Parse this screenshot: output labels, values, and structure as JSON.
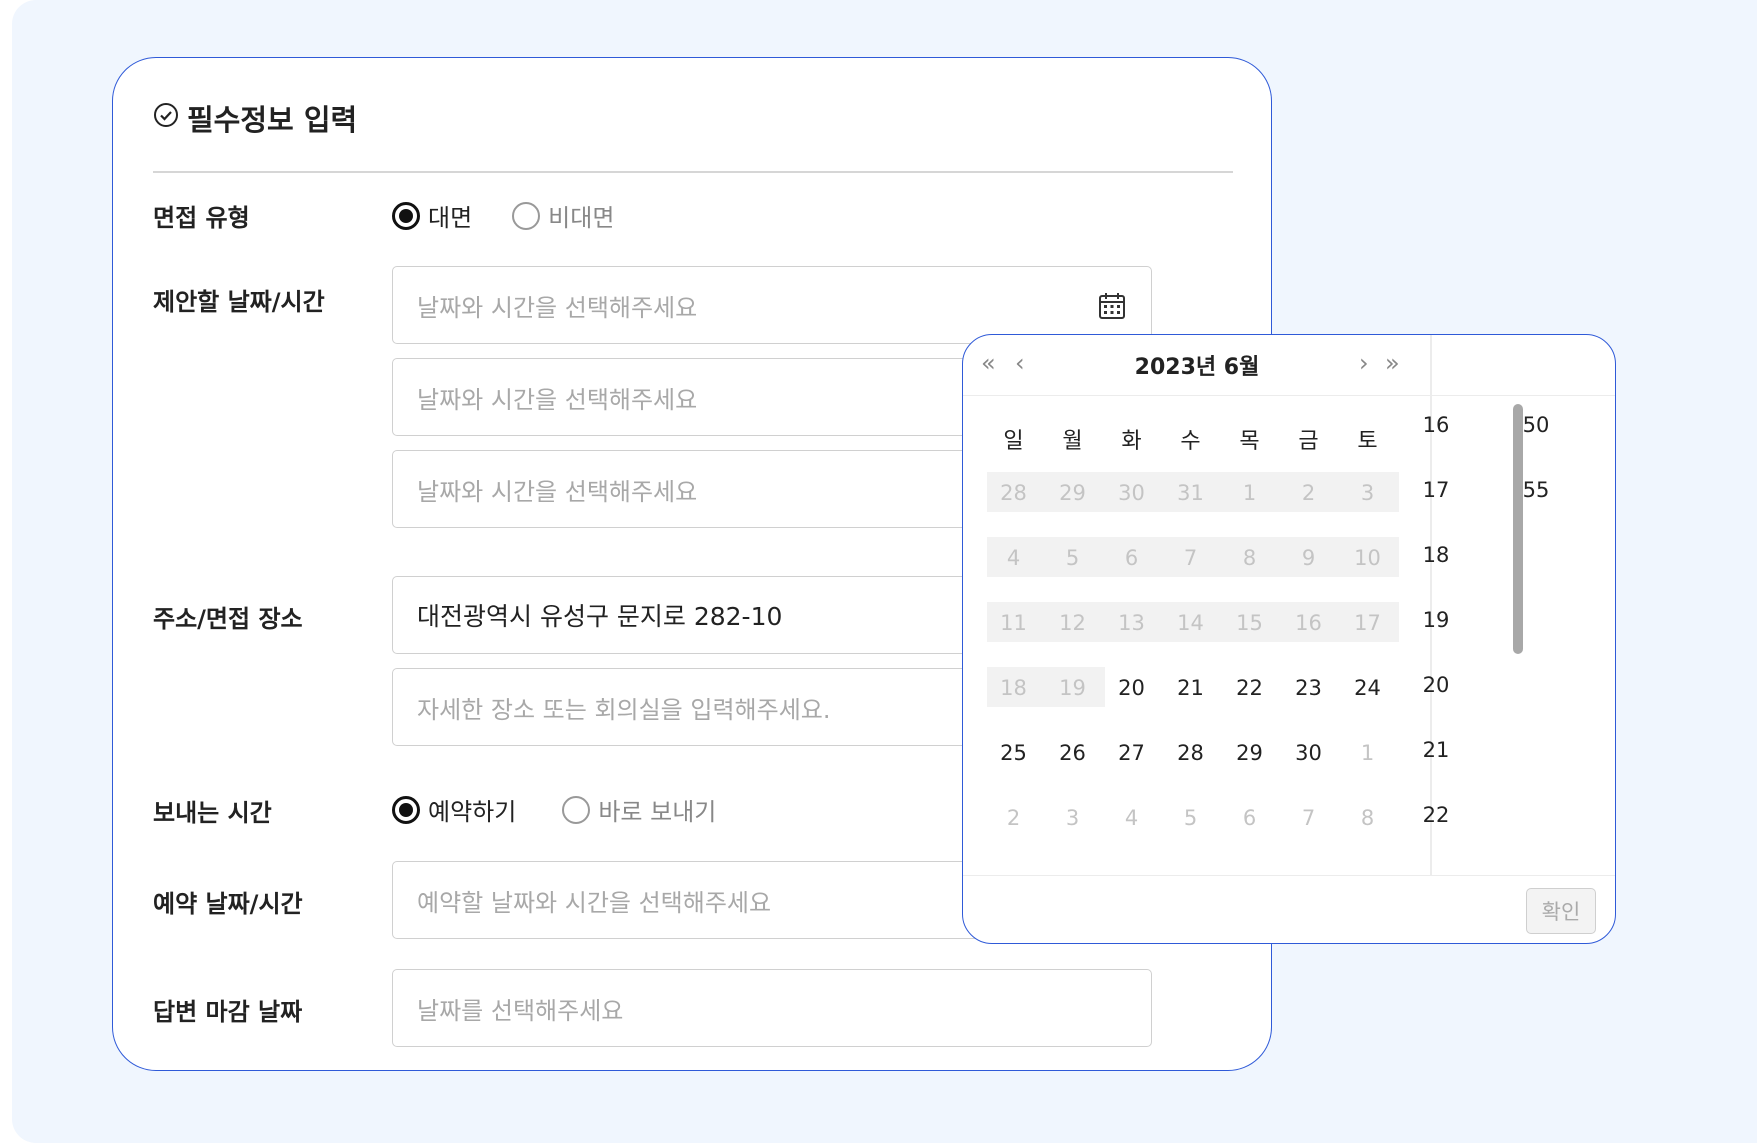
{
  "form": {
    "title": "필수정보 입력",
    "interview_type": {
      "label": "면접 유형",
      "options": [
        "대면",
        "비대면"
      ],
      "selected": "대면"
    },
    "proposed_datetime": {
      "label": "제안할 날짜/시간",
      "placeholders": [
        "날짜와 시간을 선택해주세요",
        "날짜와 시간을 선택해주세요",
        "날짜와 시간을 선택해주세요"
      ]
    },
    "location": {
      "label": "주소/면접 장소",
      "address_value": "대전광역시 유성구 문지로 282-10",
      "detail_placeholder": "자세한 장소 또는 회의실을 입력해주세요."
    },
    "send_time": {
      "label": "보내는 시간",
      "options": [
        "예약하기",
        "바로 보내기"
      ],
      "selected": "예약하기"
    },
    "reservation_datetime": {
      "label": "예약 날짜/시간",
      "placeholder": "예약할 날짜와 시간을 선택해주세요"
    },
    "answer_deadline": {
      "label": "답변 마감 날짜",
      "placeholder": "날짜를 선택해주세요"
    }
  },
  "picker": {
    "month_title": "2023년  6월",
    "nav": {
      "prev_year": "«",
      "prev_month": "‹",
      "next_month": "›",
      "next_year": "»"
    },
    "weekdays": [
      "일",
      "월",
      "화",
      "수",
      "목",
      "금",
      "토"
    ],
    "weeks": [
      [
        {
          "d": "28",
          "s": "dim"
        },
        {
          "d": "29",
          "s": "dim"
        },
        {
          "d": "30",
          "s": "dim"
        },
        {
          "d": "31",
          "s": "dim"
        },
        {
          "d": "1",
          "s": "dim"
        },
        {
          "d": "2",
          "s": "dim"
        },
        {
          "d": "3",
          "s": "dim"
        }
      ],
      [
        {
          "d": "4",
          "s": "dim"
        },
        {
          "d": "5",
          "s": "dim"
        },
        {
          "d": "6",
          "s": "dim"
        },
        {
          "d": "7",
          "s": "dim"
        },
        {
          "d": "8",
          "s": "dim"
        },
        {
          "d": "9",
          "s": "dim"
        },
        {
          "d": "10",
          "s": "dim"
        }
      ],
      [
        {
          "d": "11",
          "s": "dim"
        },
        {
          "d": "12",
          "s": "dim"
        },
        {
          "d": "13",
          "s": "dim"
        },
        {
          "d": "14",
          "s": "dim"
        },
        {
          "d": "15",
          "s": "dim"
        },
        {
          "d": "16",
          "s": "dim"
        },
        {
          "d": "17",
          "s": "dim"
        }
      ],
      [
        {
          "d": "18",
          "s": "dim"
        },
        {
          "d": "19",
          "s": "dim"
        },
        {
          "d": "20",
          "s": "act"
        },
        {
          "d": "21",
          "s": "act"
        },
        {
          "d": "22",
          "s": "act"
        },
        {
          "d": "23",
          "s": "act"
        },
        {
          "d": "24",
          "s": "act"
        }
      ],
      [
        {
          "d": "25",
          "s": "act"
        },
        {
          "d": "26",
          "s": "act"
        },
        {
          "d": "27",
          "s": "act"
        },
        {
          "d": "28",
          "s": "act"
        },
        {
          "d": "29",
          "s": "act"
        },
        {
          "d": "30",
          "s": "act"
        },
        {
          "d": "1",
          "s": "dim"
        }
      ],
      [
        {
          "d": "2",
          "s": "dim"
        },
        {
          "d": "3",
          "s": "dim"
        },
        {
          "d": "4",
          "s": "dim"
        },
        {
          "d": "5",
          "s": "dim"
        },
        {
          "d": "6",
          "s": "dim"
        },
        {
          "d": "7",
          "s": "dim"
        },
        {
          "d": "8",
          "s": "dim"
        }
      ]
    ],
    "hours": [
      "16",
      "17",
      "18",
      "19",
      "20",
      "21",
      "22"
    ],
    "minutes": [
      "50",
      "55"
    ],
    "confirm_label": "확인"
  }
}
